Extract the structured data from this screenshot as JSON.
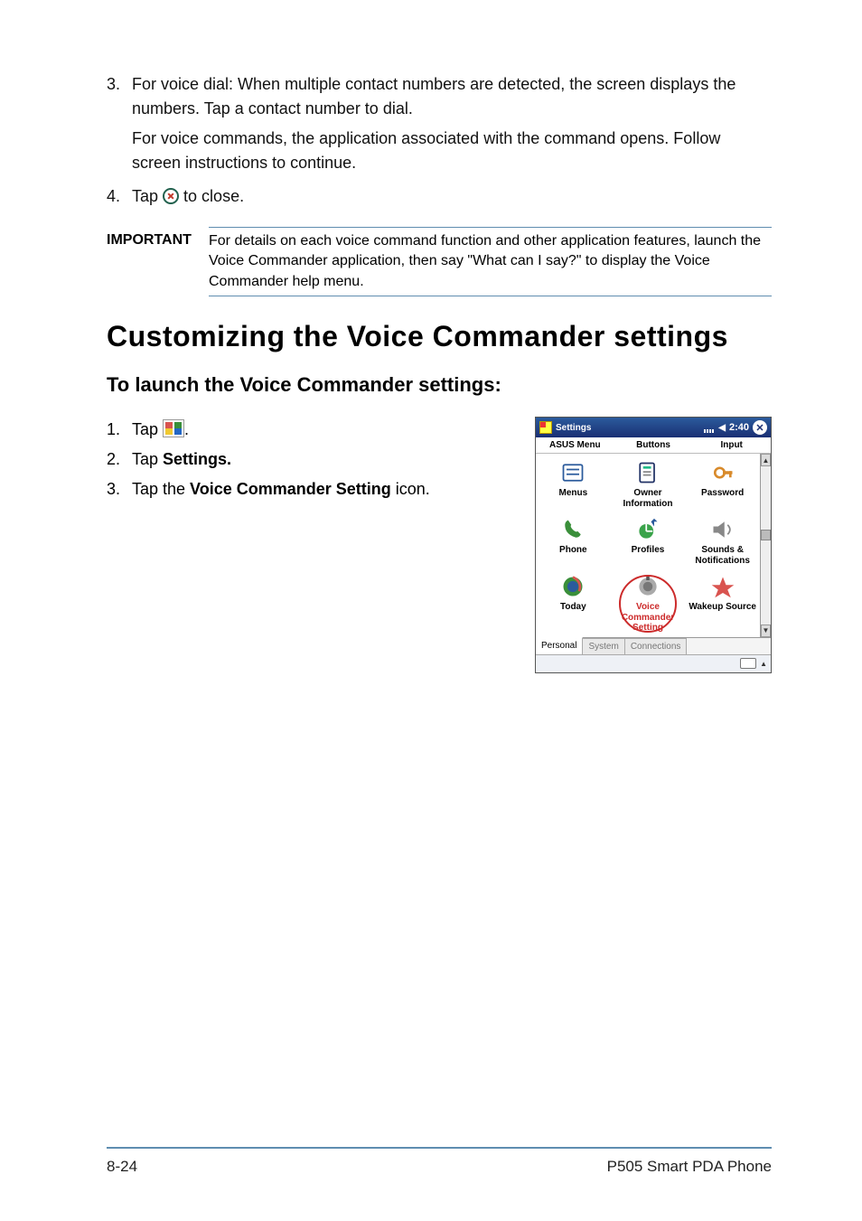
{
  "list_top": {
    "item3_num": "3.",
    "item3_text": "For voice dial: When multiple contact numbers are detected, the screen displays the numbers. Tap a contact number to dial.",
    "item3_sub": "For voice commands, the application associated with the command opens. Follow screen instructions to continue.",
    "item4_num": "4.",
    "item4_pre": "Tap ",
    "item4_post": " to close."
  },
  "important": {
    "label": "IMPORTANT",
    "text": "For details on each voice command function and other application features, launch the Voice Commander application, then say \"What can I say?\" to display the Voice Commander help menu."
  },
  "heading": "Customizing the Voice Commander settings",
  "subheading": "To launch the Voice Commander settings:",
  "steps": {
    "s1_num": "1.",
    "s1_pre": "Tap ",
    "s1_post": ".",
    "s2_num": "2.",
    "s2_pre": "Tap ",
    "s2_bold": "Settings.",
    "s3_num": "3.",
    "s3_pre": "Tap the ",
    "s3_bold": "Voice Commander Setting",
    "s3_post": " icon."
  },
  "device": {
    "title": "Settings",
    "time": "2:40",
    "header": {
      "c1": "ASUS Menu",
      "c2": "Buttons",
      "c3": "Input"
    },
    "cells": [
      {
        "name": "menus",
        "label": "Menus"
      },
      {
        "name": "owner",
        "label": "Owner Information"
      },
      {
        "name": "password",
        "label": "Password"
      },
      {
        "name": "phone",
        "label": "Phone"
      },
      {
        "name": "profiles",
        "label": "Profiles"
      },
      {
        "name": "sounds",
        "label": "Sounds & Notifications"
      },
      {
        "name": "today",
        "label": "Today"
      },
      {
        "name": "voice",
        "label": "Voice Commander Setting"
      },
      {
        "name": "wakeup",
        "label": "Wakeup Source"
      }
    ],
    "tabs": {
      "t1": "Personal",
      "t2": "System",
      "t3": "Connections"
    }
  },
  "footer": {
    "left": "8-24",
    "right": "P505 Smart PDA Phone"
  },
  "chart_data": {
    "type": "table",
    "note": "no chart in image"
  }
}
